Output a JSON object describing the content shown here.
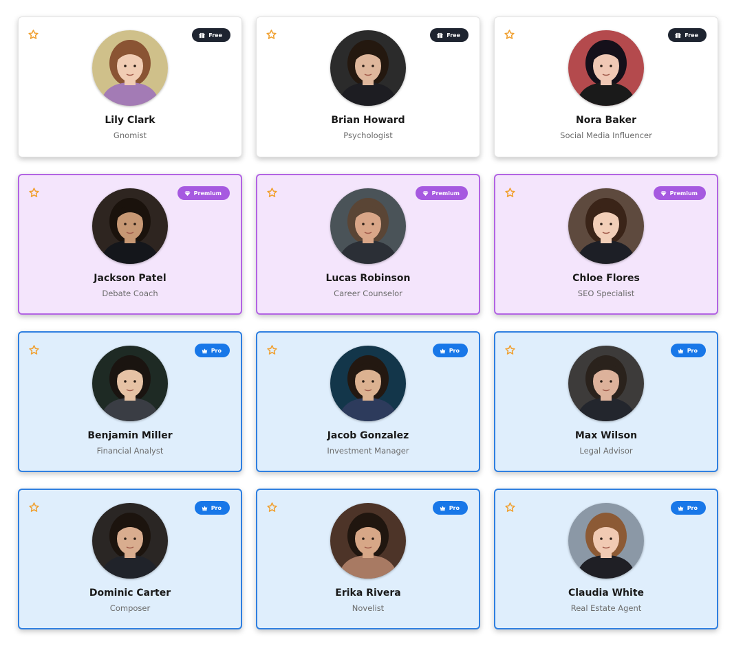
{
  "colors": {
    "free_badge": "#1e2430",
    "premium_badge": "#a659e0",
    "premium_card_bg": "#f4e5fc",
    "premium_border": "#b264e3",
    "pro_badge": "#1877e8",
    "pro_card_bg": "#dfeefc",
    "pro_border": "#2f7fe0",
    "star": "#f0a030"
  },
  "cards": [
    {
      "name": "Lily Clark",
      "role": "Gnomist",
      "tier": "free",
      "badge_label": "Free",
      "badge_icon": "gift-icon",
      "avatar": {
        "bg": "#cfc08a",
        "skin": "#f1cdb4",
        "hair": "#8a5433",
        "clothes": "#a37bb5"
      }
    },
    {
      "name": "Brian Howard",
      "role": "Psychologist",
      "tier": "free",
      "badge_label": "Free",
      "badge_icon": "gift-icon",
      "avatar": {
        "bg": "#2b2b2b",
        "skin": "#dfb79c",
        "hair": "#24180f",
        "clothes": "#1d1d22"
      }
    },
    {
      "name": "Nora Baker",
      "role": "Social Media Influencer",
      "tier": "free",
      "badge_label": "Free",
      "badge_icon": "gift-icon",
      "avatar": {
        "bg": "#b44a4d",
        "skin": "#f0c8b5",
        "hair": "#15101a",
        "clothes": "#1a1a1a"
      }
    },
    {
      "name": "Jackson Patel",
      "role": "Debate Coach",
      "tier": "premium",
      "badge_label": "Premium",
      "badge_icon": "diamond-icon",
      "avatar": {
        "bg": "#2e2520",
        "skin": "#c79874",
        "hair": "#1a120c",
        "clothes": "#14161b"
      }
    },
    {
      "name": "Lucas Robinson",
      "role": "Career Counselor",
      "tier": "premium",
      "badge_label": "Premium",
      "badge_icon": "diamond-icon",
      "avatar": {
        "bg": "#4a5358",
        "skin": "#d9a688",
        "hair": "#5a4535",
        "clothes": "#2b2f36"
      }
    },
    {
      "name": "Chloe Flores",
      "role": "SEO Specialist",
      "tier": "premium",
      "badge_label": "Premium",
      "badge_icon": "diamond-icon",
      "avatar": {
        "bg": "#5e4a3e",
        "skin": "#f2cfb8",
        "hair": "#3a2418",
        "clothes": "#1d1f26"
      }
    },
    {
      "name": "Benjamin Miller",
      "role": "Financial Analyst",
      "tier": "pro",
      "badge_label": "Pro",
      "badge_icon": "crown-icon",
      "avatar": {
        "bg": "#1e2a24",
        "skin": "#e6c2a5",
        "hair": "#1a1410",
        "clothes": "#3a3d44"
      }
    },
    {
      "name": "Jacob Gonzalez",
      "role": "Investment Manager",
      "tier": "pro",
      "badge_label": "Pro",
      "badge_icon": "crown-icon",
      "avatar": {
        "bg": "#13364a",
        "skin": "#dcb291",
        "hair": "#231811",
        "clothes": "#2d3b5c"
      }
    },
    {
      "name": "Max Wilson",
      "role": "Legal Advisor",
      "tier": "pro",
      "badge_label": "Pro",
      "badge_icon": "crown-icon",
      "avatar": {
        "bg": "#3d3b3a",
        "skin": "#ddb29b",
        "hair": "#2a221c",
        "clothes": "#23262d"
      }
    },
    {
      "name": "Dominic Carter",
      "role": "Composer",
      "tier": "pro",
      "badge_label": "Pro",
      "badge_icon": "crown-icon",
      "avatar": {
        "bg": "#2a2624",
        "skin": "#d9ad8f",
        "hair": "#1c140e",
        "clothes": "#20232a"
      }
    },
    {
      "name": "Erika Rivera",
      "role": "Novelist",
      "tier": "pro",
      "badge_label": "Pro",
      "badge_icon": "crown-icon",
      "avatar": {
        "bg": "#4d3428",
        "skin": "#d7a787",
        "hair": "#20160f",
        "clothes": "#a87a63"
      }
    },
    {
      "name": "Claudia White",
      "role": "Real Estate Agent",
      "tier": "pro",
      "badge_label": "Pro",
      "badge_icon": "crown-icon",
      "avatar": {
        "bg": "#8b98a6",
        "skin": "#f1cab3",
        "hair": "#8c5a35",
        "clothes": "#1f1f25"
      }
    }
  ]
}
